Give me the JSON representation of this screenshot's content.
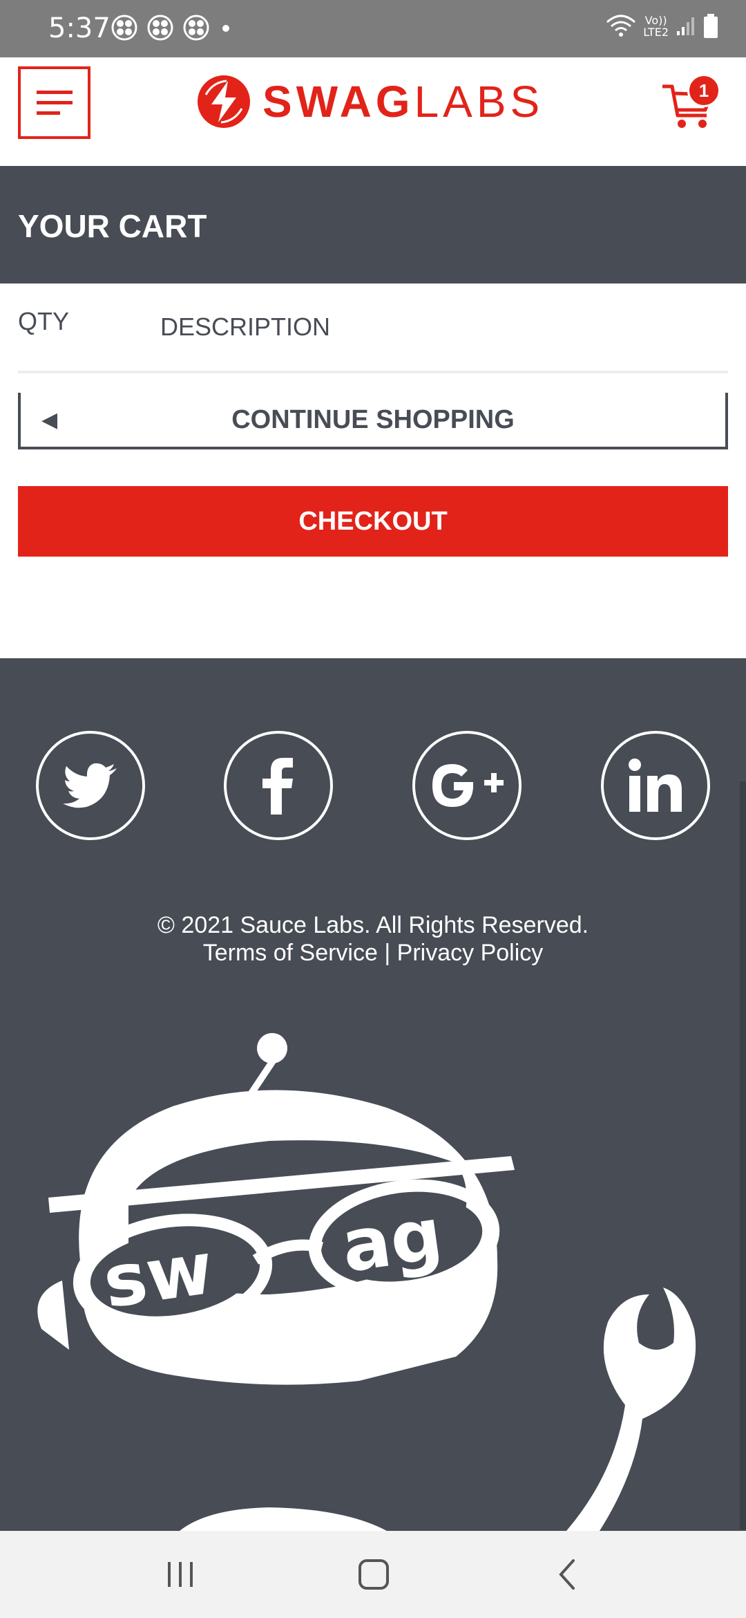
{
  "status_bar": {
    "time": "5:37",
    "network": "Vo)) LTE2",
    "network_line1": "Vo))",
    "network_line2": "LTE2"
  },
  "header": {
    "logo_bold": "SWAG",
    "logo_light": "LABS",
    "cart_count": "1"
  },
  "cart": {
    "title": "YOUR CART",
    "qty_label": "QTY",
    "description_label": "DESCRIPTION",
    "continue_label": "CONTINUE SHOPPING",
    "checkout_label": "CHECKOUT"
  },
  "footer": {
    "social": [
      "twitter",
      "facebook",
      "google-plus",
      "linkedin"
    ],
    "copyright": "© 2021 Sauce Labs. All Rights Reserved.",
    "terms": "Terms of Service",
    "separator": "|",
    "privacy": "Privacy Policy",
    "mascot_text_left": "sw",
    "mascot_text_right": "ag"
  },
  "colors": {
    "brand_red": "#e2231a",
    "dark_slate": "#474c55",
    "status_gray": "#7d7d7d"
  }
}
